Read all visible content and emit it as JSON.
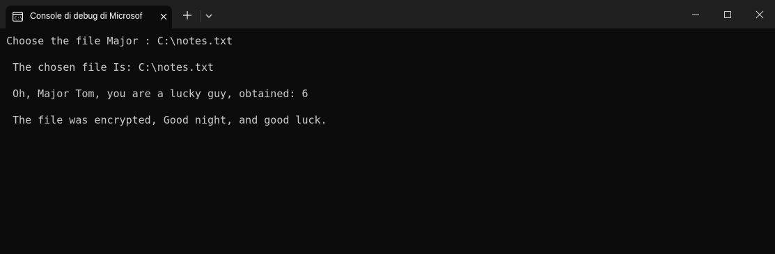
{
  "tab": {
    "title": "Console di debug di Microsof",
    "icon": "terminal-icon"
  },
  "controls": {
    "new_tab_icon": "plus-icon",
    "dropdown_icon": "chevron-down-icon",
    "minimize_icon": "minimize-icon",
    "maximize_icon": "maximize-icon",
    "close_icon": "close-icon"
  },
  "console": {
    "lines": [
      "Choose the file Major : C:\\notes.txt",
      " The chosen file Is: C:\\notes.txt",
      " Oh, Major Tom, you are a lucky guy, obtained: 6",
      " The file was encrypted, Good night, and good luck."
    ]
  },
  "colors": {
    "background": "#0c0c0c",
    "titlebar": "#202020",
    "text": "#cccccc"
  }
}
